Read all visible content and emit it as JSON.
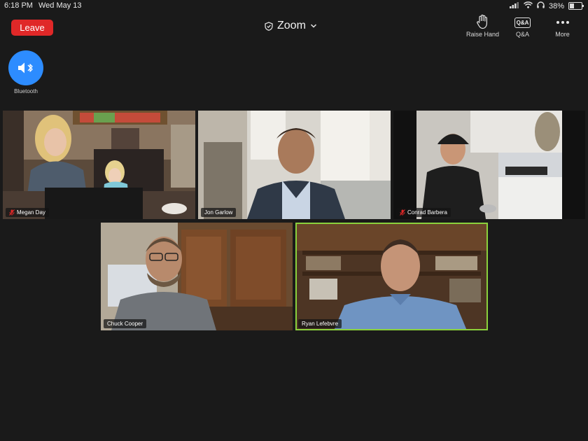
{
  "status_bar": {
    "time": "6:18 PM",
    "date": "Wed May 13",
    "battery": "38%",
    "battery_level": 0.38,
    "icons": [
      "signal-icon",
      "wifi-icon",
      "headphones-icon",
      "battery-icon"
    ]
  },
  "toolbar": {
    "leave_label": "Leave",
    "title": "Zoom",
    "actions": [
      {
        "label": "Raise Hand",
        "icon": "raise-hand-icon"
      },
      {
        "label": "Q&A",
        "icon": "qa-icon"
      },
      {
        "label": "More",
        "icon": "more-icon"
      }
    ],
    "qa_icon_text": "Q&A"
  },
  "audio": {
    "label": "Bluetooth",
    "icon": "speaker-bluetooth-icon"
  },
  "participants": [
    {
      "name": "Megan Day",
      "muted": true,
      "active": false
    },
    {
      "name": "Jon Garlow",
      "muted": false,
      "active": false
    },
    {
      "name": "Conrad Barbera",
      "muted": true,
      "active": false
    },
    {
      "name": "Chuck Cooper",
      "muted": false,
      "active": false
    },
    {
      "name": "Ryan Lefebvre",
      "muted": false,
      "active": true
    }
  ],
  "colors": {
    "background": "#1a1a1a",
    "leave": "#e02828",
    "audio_button": "#2d8cff",
    "active_speaker": "#8bd13c",
    "muted": "#e02828"
  }
}
